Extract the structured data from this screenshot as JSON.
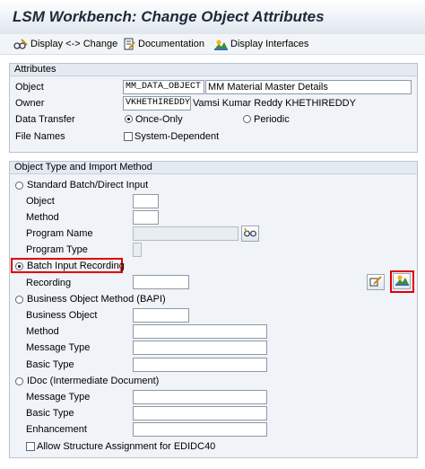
{
  "window": {
    "title": "LSM Workbench: Change Object Attributes"
  },
  "toolbar": {
    "display_change": "Display <-> Change",
    "documentation": "Documentation",
    "display_interfaces": "Display Interfaces"
  },
  "attributes": {
    "header": "Attributes",
    "object_label": "Object",
    "object_value": "MM_DATA_OBJECT",
    "object_desc": "MM Material Master Details",
    "owner_label": "Owner",
    "owner_value": "VKHETHIREDDY",
    "owner_name": "Vamsi Kumar Reddy KHETHIREDDY",
    "data_transfer_label": "Data Transfer",
    "once_only": "Once-Only",
    "once_only_selected": true,
    "periodic": "Periodic",
    "periodic_selected": false,
    "file_names_label": "File Names",
    "system_dependent": "System-Dependent",
    "system_dependent_checked": false
  },
  "import_method": {
    "header": "Object Type and Import Method",
    "standard": {
      "label": "Standard Batch/Direct Input",
      "selected": false,
      "object_label": "Object",
      "object_value": "",
      "method_label": "Method",
      "method_value": "",
      "program_name_label": "Program Name",
      "program_name_value": "",
      "program_type_label": "Program Type",
      "program_type_value": ""
    },
    "batch_input": {
      "label": "Batch Input Recording",
      "selected": true,
      "recording_label": "Recording",
      "recording_value": ""
    },
    "bapi": {
      "label": "Business Object Method  (BAPI)",
      "selected": false,
      "business_object_label": "Business Object",
      "business_object_value": "",
      "method_label": "Method",
      "method_value": "",
      "message_type_label": "Message Type",
      "message_type_value": "",
      "basic_type_label": "Basic Type",
      "basic_type_value": ""
    },
    "idoc": {
      "label": "IDoc (Intermediate Document)",
      "selected": false,
      "message_type_label": "Message Type",
      "message_type_value": "",
      "basic_type_label": "Basic Type",
      "basic_type_value": "",
      "enhancement_label": "Enhancement",
      "enhancement_value": "",
      "allow_structure_label": "Allow Structure Assignment for EDIDC40",
      "allow_structure_checked": false
    }
  },
  "icons": {
    "display_change": "glasses-pencil-icon",
    "documentation": "document-pencil-icon",
    "display_interfaces": "mountain-landscape-icon",
    "program_lookup": "glasses-icon",
    "edit_recording": "pencil-arrow-icon",
    "overview_recording": "mountain-landscape-icon"
  },
  "colors": {
    "highlight": "#e00000",
    "header_bg": "#e4eaf1",
    "panel_bg": "#f0f3f7"
  }
}
